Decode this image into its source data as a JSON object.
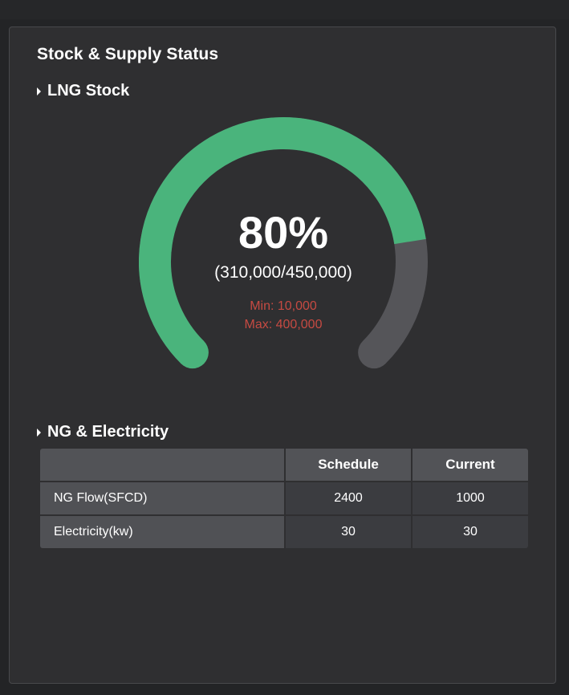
{
  "panel": {
    "title": "Stock & Supply Status"
  },
  "lng": {
    "section_title": "LNG Stock",
    "gauge": {
      "percent_label": "80%",
      "fill_fraction": 0.8,
      "ratio_label": "(310,000/450,000)",
      "min_label": "Min: 10,000",
      "max_label": "Max: 400,000",
      "colors": {
        "fill": "#4ab47c",
        "track": "#555559",
        "limits_text": "#c64a42"
      }
    }
  },
  "ng": {
    "section_title": "NG & Electricity",
    "table": {
      "headers": [
        "",
        "Schedule",
        "Current"
      ],
      "rows": [
        {
          "label": "NG Flow(SFCD)",
          "schedule": "2400",
          "current": "1000"
        },
        {
          "label": "Electricity(kw)",
          "schedule": "30",
          "current": "30"
        }
      ]
    }
  }
}
